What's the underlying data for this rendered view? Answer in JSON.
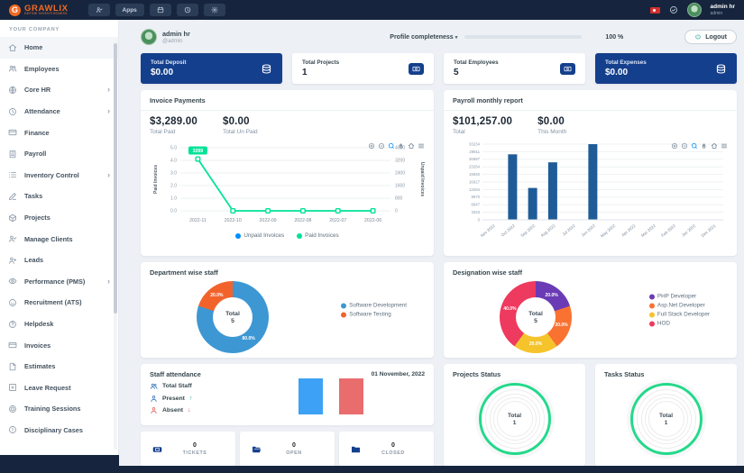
{
  "topbar": {
    "logo": {
      "text": "GRAWLIX",
      "tagline": "DEFINE INVENTIVENESS",
      "accent": "#f26a22"
    },
    "nav": [
      {
        "icon": "user-roles-icon"
      },
      {
        "label": "Apps"
      },
      {
        "icon": "calendar-icon"
      },
      {
        "icon": "history-clock-icon"
      },
      {
        "icon": "settings-gear-icon"
      }
    ],
    "user": {
      "name": "admin hr",
      "role": "admin"
    }
  },
  "sidebar": {
    "section_label": "YOUR COMPANY",
    "items": [
      {
        "label": "Home",
        "icon": "home-icon",
        "active": true
      },
      {
        "label": "Employees",
        "icon": "employees-icon"
      },
      {
        "label": "Core HR",
        "icon": "core-hr-icon",
        "expandable": true
      },
      {
        "label": "Attendance",
        "icon": "attendance-icon",
        "expandable": true
      },
      {
        "label": "Finance",
        "icon": "finance-icon"
      },
      {
        "label": "Payroll",
        "icon": "payroll-icon"
      },
      {
        "label": "Inventory Control",
        "icon": "inventory-icon",
        "expandable": true
      },
      {
        "label": "Tasks",
        "icon": "tasks-icon"
      },
      {
        "label": "Projects",
        "icon": "projects-icon"
      },
      {
        "label": "Manage Clients",
        "icon": "manage-clients-icon"
      },
      {
        "label": "Leads",
        "icon": "leads-icon"
      },
      {
        "label": "Performance (PMS)",
        "icon": "performance-icon",
        "expandable": true
      },
      {
        "label": "Recruitment (ATS)",
        "icon": "recruitment-icon"
      },
      {
        "label": "Helpdesk",
        "icon": "helpdesk-icon"
      },
      {
        "label": "Invoices",
        "icon": "invoices-icon"
      },
      {
        "label": "Estimates",
        "icon": "estimates-icon"
      },
      {
        "label": "Leave Request",
        "icon": "leave-request-icon"
      },
      {
        "label": "Training Sessions",
        "icon": "training-icon"
      },
      {
        "label": "Disciplinary Cases",
        "icon": "disciplinary-icon"
      }
    ]
  },
  "header": {
    "name": "admin hr",
    "handle": "@admin",
    "completeness_label": "Profile completeness",
    "caret": "▾",
    "completeness_pct": "100 %",
    "progress_color": "#2aa79b",
    "logout_label": "Logout"
  },
  "stat_cards": [
    {
      "label": "Total Deposit",
      "value": "$0.00",
      "variant": "dark",
      "icon": "coins-icon"
    },
    {
      "label": "Total Projects",
      "value": "1",
      "variant": "light",
      "icon": "banknote-icon"
    },
    {
      "label": "Total Employees",
      "value": "5",
      "variant": "light",
      "icon": "banknote-icon"
    },
    {
      "label": "Total Expenses",
      "value": "$0.00",
      "variant": "dark",
      "icon": "coins-icon"
    }
  ],
  "colors": {
    "primary_dark": "#143f8c",
    "topbar": "#16253d",
    "page_bg": "#edf0f5"
  },
  "invoice_panel": {
    "title": "Invoice Payments",
    "paid_value": "$3,289.00",
    "paid_label": "Total Paid",
    "unpaid_value": "$0.00",
    "unpaid_label": "Total Un Paid"
  },
  "payroll_panel": {
    "title": "Payroll monthly report",
    "total_value": "$101,257.00",
    "total_label": "Total",
    "month_value": "$0.00",
    "month_label": "This Month"
  },
  "department_panel": {
    "title": "Department wise staff"
  },
  "designation_panel": {
    "title": "Designation wise staff"
  },
  "attendance_panel": {
    "title": "Staff attendance",
    "date": "01 November, 2022",
    "rows": [
      {
        "label": "Total Staff",
        "icon": "team-icon"
      },
      {
        "label": "Present",
        "icon": "person-icon",
        "arrow": "↑"
      },
      {
        "label": "Absent",
        "icon": "person-icon",
        "arrow": "↓"
      }
    ]
  },
  "tickets": [
    {
      "count": "0",
      "label": "TICKETS",
      "icon": "ticket-icon"
    },
    {
      "count": "0",
      "label": "OPEN",
      "icon": "folder-open-icon"
    },
    {
      "count": "0",
      "label": "CLOSED",
      "icon": "folder-icon"
    }
  ],
  "projects_panel": {
    "title": "Projects Status"
  },
  "tasks_panel": {
    "title": "Tasks Status"
  },
  "chart_data": [
    {
      "id": "invoice_payments",
      "type": "line",
      "categories": [
        "2022-11",
        "2022-10",
        "2022-09",
        "2022-08",
        "2022-07",
        "2022-06"
      ],
      "series": [
        {
          "name": "Unpaid Invoices",
          "color": "#008FFB",
          "values": [
            0,
            0,
            0,
            0,
            0,
            0
          ]
        },
        {
          "name": "Paid Invoices",
          "color": "#00E396",
          "values": [
            3289,
            0,
            0,
            0,
            0,
            0
          ]
        }
      ],
      "y_left": {
        "label": "Paid Invoices",
        "min": 0,
        "max": 5,
        "tick_step": 1
      },
      "y_right": {
        "label": "Unpaid Invoices",
        "min": 0,
        "max": 4000,
        "tick_step": 800
      },
      "point_label": {
        "series": "Paid Invoices",
        "index": 0,
        "text": "3289"
      },
      "legend_position": "bottom",
      "grid": true
    },
    {
      "id": "payroll_monthly",
      "type": "bar",
      "categories": [
        "Nov 2022",
        "Oct 2022",
        "Sep 2022",
        "Aug 2022",
        "Jul 2022",
        "Jun 2022",
        "May 2022",
        "Apr 2022",
        "Mar 2022",
        "Feb 2022",
        "Jan 2022",
        "Dec 2021"
      ],
      "values": [
        0,
        28766,
        14000,
        25257,
        0,
        33234,
        0,
        0,
        0,
        0,
        0,
        0
      ],
      "bar_color": "#1f5c97",
      "ylim": [
        0,
        33234
      ],
      "yticks": [
        0,
        3323,
        6647,
        9970,
        13294,
        16617,
        19940,
        23264,
        26587,
        29911,
        33234
      ],
      "grid": true
    },
    {
      "id": "department_staff",
      "type": "pie",
      "center_label": "Total",
      "center_value": "5",
      "slices": [
        {
          "label": "Software Development",
          "pct": 80.0,
          "display": "80.0%",
          "color": "#3d97d3"
        },
        {
          "label": "Software Testing",
          "pct": 20.0,
          "display": "20.0%",
          "color": "#f2632c"
        }
      ],
      "legend_position": "right"
    },
    {
      "id": "designation_staff",
      "type": "pie",
      "center_label": "Total",
      "center_value": "5",
      "slices": [
        {
          "label": "PHP Developer",
          "pct": 20.0,
          "display": "20.0%",
          "color": "#6a3bb5"
        },
        {
          "label": "Asp.Net Developer",
          "pct": 20.0,
          "display": "20.0%",
          "color": "#f97232"
        },
        {
          "label": "Full Stack Developer",
          "pct": 20.0,
          "display": "20.0%",
          "color": "#f5c42d"
        },
        {
          "label": "HOD",
          "pct": 40.0,
          "display": "40.0%",
          "color": "#ee3a5e"
        }
      ],
      "legend_position": "right"
    },
    {
      "id": "staff_attendance",
      "type": "bar",
      "series": [
        {
          "name": "Present",
          "color": "#3da2f5",
          "value": 1
        },
        {
          "name": "Absent",
          "color": "#e96d6d",
          "value": 1
        }
      ]
    },
    {
      "id": "projects_status",
      "type": "radial",
      "ring_color": "#23d98a",
      "center_label": "Total",
      "center_value": "1"
    },
    {
      "id": "tasks_status",
      "type": "radial",
      "ring_color": "#23d98a",
      "center_label": "Total",
      "center_value": "1"
    }
  ]
}
